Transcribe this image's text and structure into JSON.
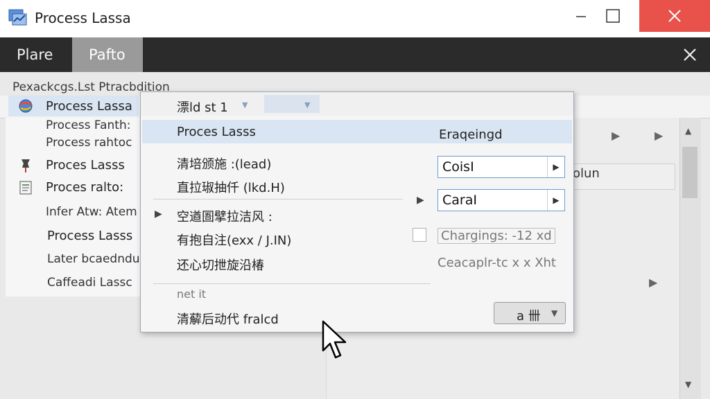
{
  "window": {
    "title": "Process Lassa",
    "icons": {
      "app": "app-icon",
      "minimize": "minimize-icon",
      "maximize": "maximize-icon",
      "close": "close-icon"
    },
    "close_color": "#e9524a"
  },
  "tabs": [
    {
      "label": "Plare",
      "active": false
    },
    {
      "label": "Pafto",
      "active": true
    }
  ],
  "subheader": "Pexackcgs.Lst Ptracbdition",
  "left_list": [
    {
      "label": "Process Lassa",
      "icon": "globe-icon"
    },
    {
      "label": "Process Fanth:",
      "icon": ""
    },
    {
      "label": "Process rahtoc",
      "icon": ""
    },
    {
      "label": "Proces Lasss",
      "icon": "pin-icon"
    },
    {
      "label": "Proces ralto:",
      "icon": "document-icon"
    },
    {
      "label": "Infer Atw: Atem",
      "icon": ""
    },
    {
      "label": "Process Lasss",
      "icon": ""
    },
    {
      "label": "Later bcaedndu",
      "icon": ""
    },
    {
      "label": "Caffeadi Lassc",
      "icon": ""
    }
  ],
  "menu": {
    "header": "漂ld st 1",
    "items": [
      {
        "label": "Proces Lasss",
        "highlighted": true
      },
      {
        "label": "清培颁施 :(lead)"
      },
      {
        "label": "直拉琡抽仟 (lkd.H)"
      },
      {
        "label": "空遒圄擘拉洁风 :"
      },
      {
        "label": "有抱自注(exx / J.IN)"
      },
      {
        "label": "还心切抴旋沿椿"
      },
      {
        "label": "net it"
      },
      {
        "label": "清薢后动代 fralcd"
      }
    ],
    "right_title": "Eraqeingd",
    "field1": "CoisI",
    "field2": "CaraI",
    "charge_label": "Chargings: -12 xd",
    "note": "Ceacaplr-tc x x Xht",
    "dropdown_label": "a 卌"
  },
  "right_header": "olun",
  "colors": {
    "tab_bar": "#2b2b2b",
    "active_tab": "#9a9a9a",
    "menu_highlight": "#d9e5f3",
    "field_border": "#6f9ad0"
  }
}
